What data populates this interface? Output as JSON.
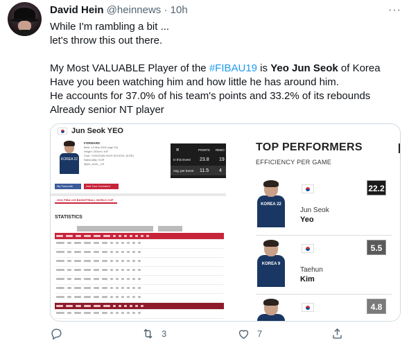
{
  "tweet": {
    "author_name": "David Hein",
    "author_handle": "@heinnews",
    "separator": "·",
    "time": "10h",
    "more_icon": "more-icon",
    "lines": {
      "l1": "While I'm rambling a bit ...",
      "l2": "let's throw this out there.",
      "l3_a": "My Most VALUABLE Player of the ",
      "l3_hashtag": "#FIBAU19",
      "l3_b": " is ",
      "l3_bold": "Yeo Jun Seok",
      "l3_c": " of Korea",
      "l4": "Have you been watching him and how little he has around him.",
      "l5": "He accounts for 37.0% of his team's points and 33.2% of its rebounds",
      "l6": "Already senior NT player"
    }
  },
  "media_left": {
    "player_name": "Jun Seok YEO",
    "role": "FORWARD",
    "info_lines": [
      "Birth: 13 Mar 2002 (age 19)",
      "Height: 203cm / 6'8\"",
      "Club: YONGSAN HIGH SCHOOL (KOR)",
      "Nationality: KOR",
      "@jun_seok__03"
    ],
    "stat_headers": [
      "POINTS",
      "REBO"
    ],
    "stat_rows": [
      {
        "label": "In this Event",
        "points": "23.8",
        "sub": "19"
      },
      {
        "label": "Avg. per Event",
        "points": "11.5",
        "sub": "4"
      }
    ],
    "fav_button": "My Favourite",
    "comment_button": "Add Your Comment",
    "event_tab": "2021 FIBA U19 BASKETBALL WORLD CUP",
    "statistics_title": "STATISTICS",
    "jersey_text": "KOREA 22"
  },
  "media_right": {
    "title": "TOP PERFORMERS",
    "subtitle": "EFFICIENCY PER GAME",
    "players": [
      {
        "first": "Jun Seok",
        "last": "Yeo",
        "score": "22.2",
        "score_color": "#1a1a1a",
        "jersey": "KOREA 22"
      },
      {
        "first": "Taehun",
        "last": "Kim",
        "score": "5.5",
        "score_color": "#5a5a5a",
        "jersey": "KOREA 9"
      },
      {
        "first": "",
        "last": "",
        "score": "4.8",
        "score_color": "#7a7a7a",
        "jersey": ""
      }
    ]
  },
  "actions": {
    "reply_count": "",
    "retweet_count": "3",
    "like_count": "7",
    "icons": [
      "reply-icon",
      "retweet-icon",
      "like-icon",
      "share-icon"
    ]
  }
}
